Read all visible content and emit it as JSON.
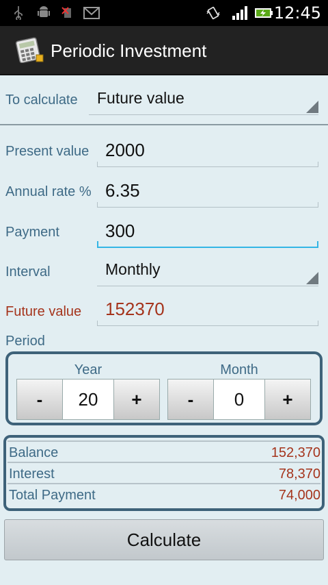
{
  "status_bar": {
    "time": "12:45",
    "icons": [
      "usb-icon",
      "android-debug-icon",
      "no-sim-icon",
      "gmail-icon",
      "vibrate-icon",
      "signal-icon",
      "battery-charging-icon"
    ]
  },
  "app": {
    "title": "Periodic Investment",
    "icon": "calculator-icon"
  },
  "to_calculate": {
    "label": "To calculate",
    "value": "Future value"
  },
  "present_value": {
    "label": "Present value",
    "value": "2000"
  },
  "annual_rate": {
    "label": "Annual rate %",
    "value": "6.35"
  },
  "payment": {
    "label": "Payment",
    "value": "300"
  },
  "interval": {
    "label": "Interval",
    "value": "Monthly"
  },
  "future_value": {
    "label": "Future value",
    "value": "152370"
  },
  "period": {
    "label": "Period",
    "year": {
      "label": "Year",
      "value": "20",
      "minus": "-",
      "plus": "+"
    },
    "month": {
      "label": "Month",
      "value": "0",
      "minus": "-",
      "plus": "+"
    }
  },
  "results": [
    {
      "label": "Balance",
      "value": "152,370"
    },
    {
      "label": "Interest",
      "value": "78,370"
    },
    {
      "label": "Total Payment",
      "value": "74,000"
    }
  ],
  "calculate_button": "Calculate",
  "colors": {
    "accent_label": "#3e6a86",
    "result_value": "#a5341c",
    "focus": "#33b5e5",
    "background": "#e2eef2"
  }
}
